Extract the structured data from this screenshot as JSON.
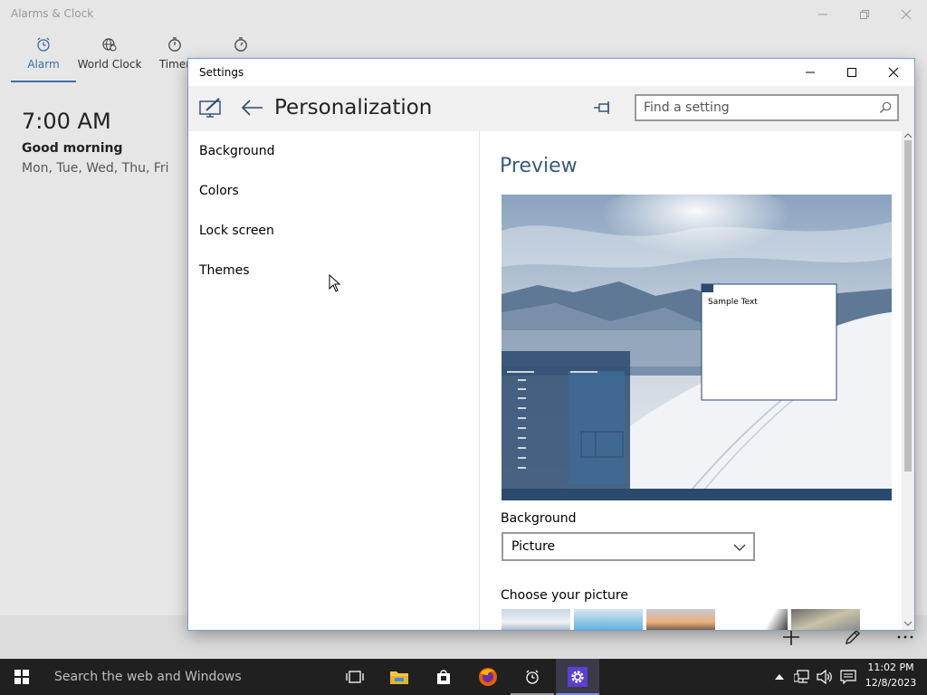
{
  "alarms_app": {
    "title": "Alarms & Clock",
    "tabs": [
      {
        "label": "Alarm",
        "icon": "alarm-clock-icon"
      },
      {
        "label": "World Clock",
        "icon": "globe-icon"
      },
      {
        "label": "Timer",
        "icon": "timer-icon"
      },
      {
        "label": "",
        "icon": "stopwatch-icon"
      }
    ],
    "alarm": {
      "time": "7:00 AM",
      "name": "Good morning",
      "days": "Mon, Tue, Wed, Thu, Fri"
    },
    "bottom_actions": [
      "add-icon",
      "pencil-icon",
      "more-icon"
    ]
  },
  "settings": {
    "window_title": "Settings",
    "page_title": "Personalization",
    "search_placeholder": "Find a setting",
    "nav_items": [
      {
        "label": "Background"
      },
      {
        "label": "Colors"
      },
      {
        "label": "Lock screen"
      },
      {
        "label": "Themes"
      }
    ],
    "preview_heading": "Preview",
    "preview_sample_text": "Sample Text",
    "background_label": "Background",
    "background_value": "Picture",
    "choose_picture_label": "Choose your picture",
    "accent_color": "#2b4a6e"
  },
  "taskbar": {
    "search_text": "Search the web and Windows",
    "time": "11:02 PM",
    "date": "12/8/2023",
    "active_app": "settings"
  }
}
